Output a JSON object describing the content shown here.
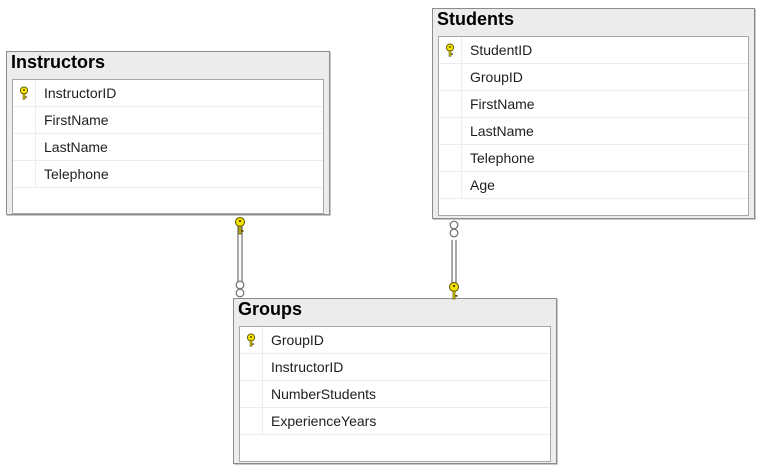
{
  "diagram": {
    "tables": [
      {
        "id": "instructors",
        "title": "Instructors",
        "columns": [
          {
            "name": "InstructorID",
            "primary_key": true
          },
          {
            "name": "FirstName",
            "primary_key": false
          },
          {
            "name": "LastName",
            "primary_key": false
          },
          {
            "name": "Telephone",
            "primary_key": false
          }
        ]
      },
      {
        "id": "students",
        "title": "Students",
        "columns": [
          {
            "name": "StudentID",
            "primary_key": true
          },
          {
            "name": "GroupID",
            "primary_key": false
          },
          {
            "name": "FirstName",
            "primary_key": false
          },
          {
            "name": "LastName",
            "primary_key": false
          },
          {
            "name": "Telephone",
            "primary_key": false
          },
          {
            "name": "Age",
            "primary_key": false
          }
        ]
      },
      {
        "id": "groups",
        "title": "Groups",
        "columns": [
          {
            "name": "GroupID",
            "primary_key": true
          },
          {
            "name": "InstructorID",
            "primary_key": false
          },
          {
            "name": "NumberStudents",
            "primary_key": false
          },
          {
            "name": "ExperienceYears",
            "primary_key": false
          }
        ]
      }
    ],
    "relationships": [
      {
        "from": "instructors",
        "to": "groups",
        "one_end": "instructors",
        "many_end": "groups"
      },
      {
        "from": "groups",
        "to": "students",
        "one_end": "groups",
        "many_end": "students"
      }
    ],
    "colors": {
      "key_fill": "#f5e300",
      "key_stroke": "#5a5000",
      "connector": "#6e6e6e",
      "header_bg": "#ececec"
    },
    "icons": {
      "primary_key": "key-icon",
      "one_end": "key-icon",
      "many_end": "infinity-icon"
    }
  }
}
